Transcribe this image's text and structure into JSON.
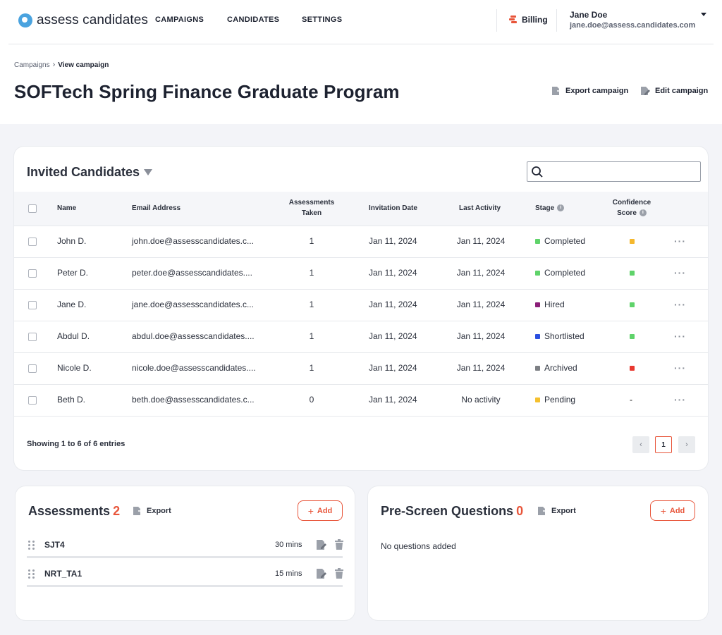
{
  "app": {
    "logo_text": "assess candidates"
  },
  "nav": {
    "links": [
      "CAMPAIGNS",
      "CANDIDATES",
      "SETTINGS"
    ],
    "billing": "Billing",
    "user_name": "Jane Doe",
    "user_email": "jane.doe@assess.candidates.com"
  },
  "breadcrumb": {
    "parent": "Campaigns",
    "current": "View campaign"
  },
  "page": {
    "title": "SOFTech Spring Finance Graduate Program",
    "export_campaign": "Export campaign",
    "edit_campaign": "Edit campaign"
  },
  "candidates": {
    "title": "Invited Candidates",
    "search_placeholder": "",
    "columns": {
      "name": "Name",
      "email": "Email Address",
      "assessments_line1": "Assessments",
      "assessments_line2": "Taken",
      "invitation_date": "Invitation Date",
      "last_activity": "Last Activity",
      "stage": "Stage",
      "confidence_line1": "Confidence",
      "confidence_line2": "Score"
    },
    "rows": [
      {
        "name": "John D.",
        "email": "john.doe@assesscandidates.c...",
        "assessments": "1",
        "invited": "Jan 11, 2024",
        "last": "Jan 11, 2024",
        "stage": "Completed",
        "stage_color": "#5fd36a",
        "confidence_color": "#f5b82e",
        "confidence": ""
      },
      {
        "name": "Peter D.",
        "email": "peter.doe@assesscandidates....",
        "assessments": "1",
        "invited": "Jan 11, 2024",
        "last": "Jan 11, 2024",
        "stage": "Completed",
        "stage_color": "#5fd36a",
        "confidence_color": "#5fd36a",
        "confidence": ""
      },
      {
        "name": "Jane D.",
        "email": "jane.doe@assesscandidates.c...",
        "assessments": "1",
        "invited": "Jan 11, 2024",
        "last": "Jan 11, 2024",
        "stage": "Hired",
        "stage_color": "#8b1f78",
        "confidence_color": "#5fd36a",
        "confidence": ""
      },
      {
        "name": "Abdul D.",
        "email": "abdul.doe@assesscandidates....",
        "assessments": "1",
        "invited": "Jan 11, 2024",
        "last": "Jan 11, 2024",
        "stage": "Shortlisted",
        "stage_color": "#2b4fe0",
        "confidence_color": "#5fd36a",
        "confidence": ""
      },
      {
        "name": "Nicole D.",
        "email": "nicole.doe@assesscandidates....",
        "assessments": "1",
        "invited": "Jan 11, 2024",
        "last": "Jan 11, 2024",
        "stage": "Archived",
        "stage_color": "#7d7f84",
        "confidence_color": "#e8382f",
        "confidence": ""
      },
      {
        "name": "Beth D.",
        "email": "beth.doe@assesscandidates.c...",
        "assessments": "0",
        "invited": "Jan 11, 2024",
        "last": "No activity",
        "stage": "Pending",
        "stage_color": "#f5c02e",
        "confidence_color": "",
        "confidence": "-"
      }
    ],
    "more_glyph": "···",
    "showing": "Showing 1 to 6 of 6 entries",
    "current_page": "1"
  },
  "assessments": {
    "title": "Assessments",
    "count": "2",
    "export": "Export",
    "add": "Add",
    "items": [
      {
        "name": "SJT4",
        "duration": "30 mins"
      },
      {
        "name": "NRT_TA1",
        "duration": "15 mins"
      }
    ]
  },
  "prescreen": {
    "title": "Pre-Screen Questions",
    "count": "0",
    "export": "Export",
    "add": "Add",
    "empty": "No questions added"
  },
  "colors": {
    "accent": "#e8553a",
    "brand": "#4aa3df"
  }
}
